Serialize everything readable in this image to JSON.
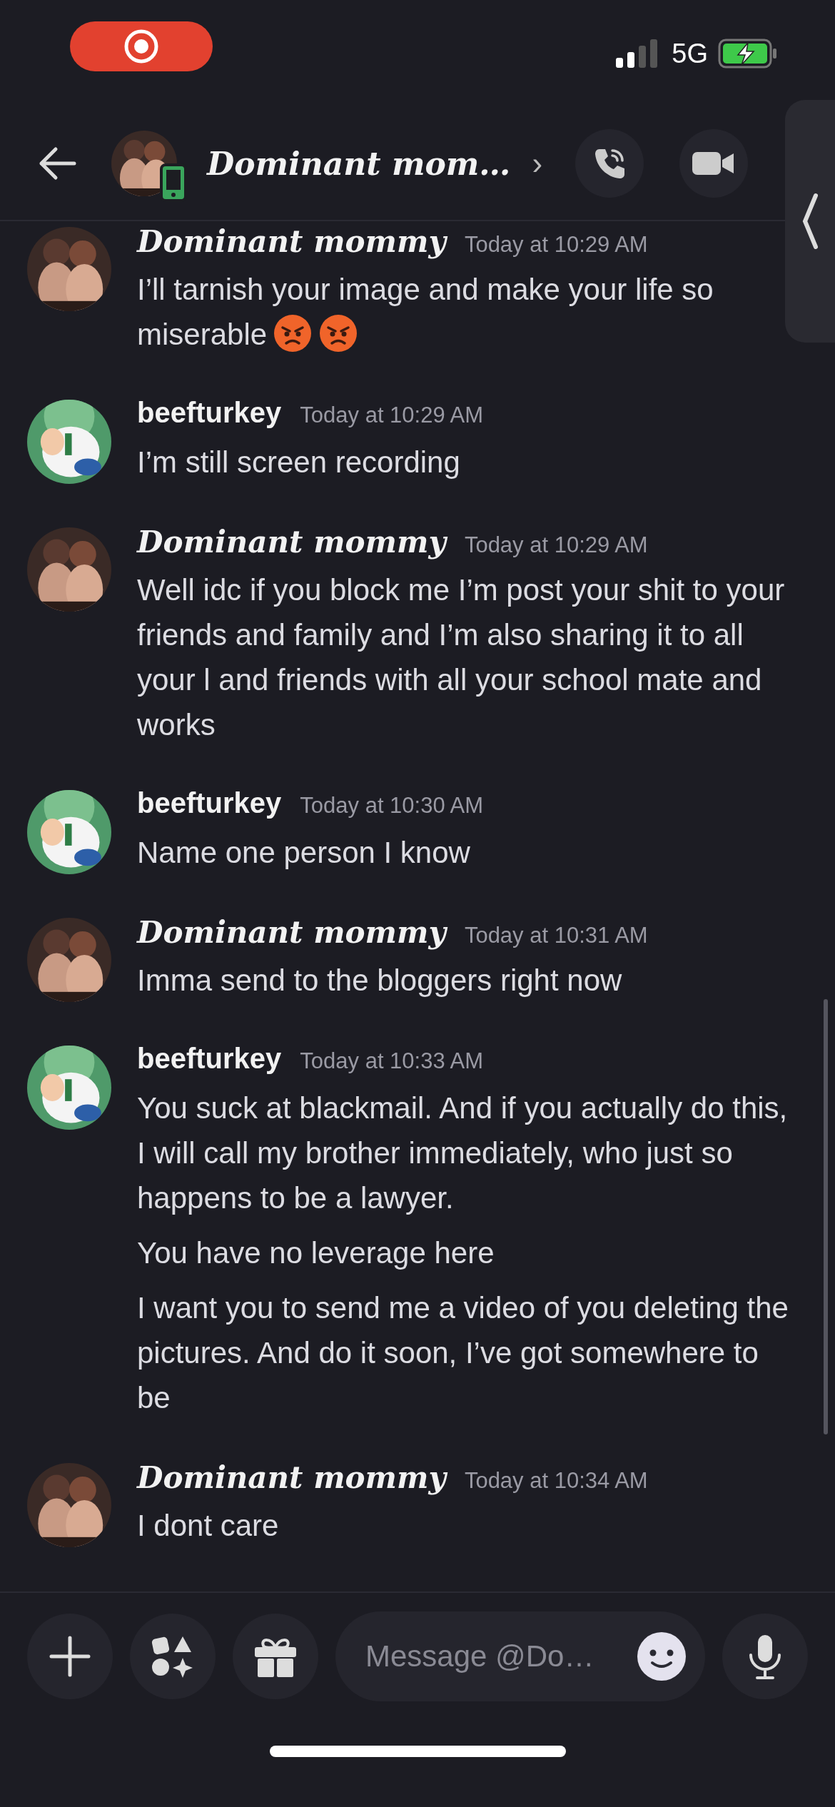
{
  "status_bar": {
    "network": "5G"
  },
  "header": {
    "title": "Dominant mom…",
    "chevron": "›"
  },
  "messages": [
    {
      "author": "Dominant mommy",
      "kind": "script",
      "time": "Today at 10:29 AM",
      "paragraphs": [
        {
          "text": "I’ll tarnish your image and make your life so miserable",
          "emoji": [
            {
              "kind": "angry"
            },
            {
              "kind": "angry"
            }
          ]
        }
      ]
    },
    {
      "author": "beefturkey",
      "kind": "plain",
      "time": "Today at 10:29 AM",
      "paragraphs": [
        {
          "text": "I’m still screen recording"
        }
      ]
    },
    {
      "author": "Dominant mommy",
      "kind": "script",
      "time": "Today at 10:29 AM",
      "paragraphs": [
        {
          "text": "Well idc if you block me I’m post your shit to your friends and family and I’m also sharing it to all your l and friends with all your school mate and works"
        }
      ]
    },
    {
      "author": "beefturkey",
      "kind": "plain",
      "time": "Today at 10:30 AM",
      "paragraphs": [
        {
          "text": "Name one person I know"
        }
      ]
    },
    {
      "author": "Dominant mommy",
      "kind": "script",
      "time": "Today at 10:31 AM",
      "paragraphs": [
        {
          "text": "Imma send to the bloggers right now"
        }
      ]
    },
    {
      "author": "beefturkey",
      "kind": "plain",
      "time": "Today at 10:33 AM",
      "paragraphs": [
        {
          "text": "You suck at blackmail. And if you actually do this, I will call my brother immediately, who just so happens to be a lawyer."
        },
        {
          "text": "You have no leverage here"
        },
        {
          "text": "I want you to send me a video of you deleting the pictures. And do it soon, I’ve got somewhere to be"
        }
      ]
    },
    {
      "author": "Dominant mommy",
      "kind": "script",
      "time": "Today at 10:34 AM",
      "paragraphs": [
        {
          "text": "I dont care"
        }
      ]
    }
  ],
  "composer": {
    "placeholder": "Message @Do…"
  }
}
